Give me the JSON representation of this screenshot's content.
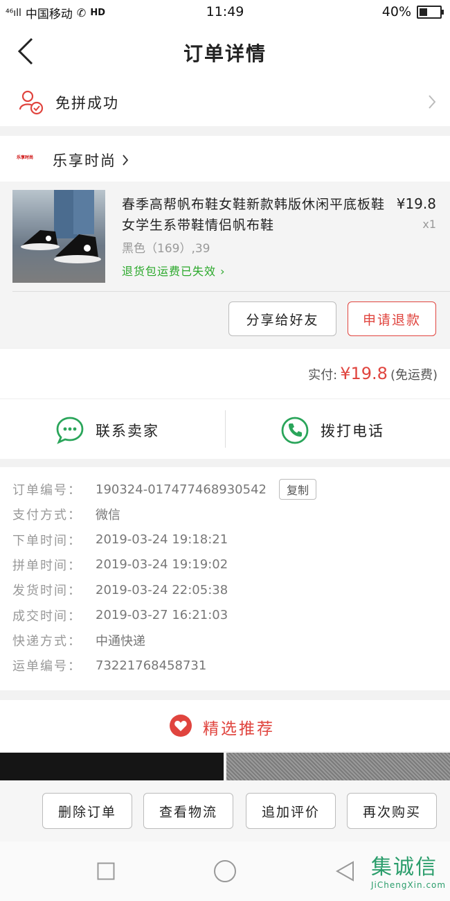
{
  "status_bar": {
    "network": "⁴⁶ıll",
    "carrier": "中国移动",
    "hd": "HD",
    "time": "11:49",
    "battery_label": "40%",
    "battery_level": 0.4
  },
  "header": {
    "title": "订单详情"
  },
  "group_status": {
    "label": "免拼成功"
  },
  "shop": {
    "logo_text": "乐享时尚",
    "name": "乐享时尚"
  },
  "product": {
    "title": "春季高帮帆布鞋女鞋新款韩版休闲平底板鞋女学生系带鞋情侣帆布鞋",
    "spec": "黑色（169）,39",
    "return_shipping": "退货包运费已失效",
    "price": "¥19.8",
    "qty": "x1"
  },
  "actions": {
    "share": "分享给好友",
    "refund": "申请退款"
  },
  "payment": {
    "label": "实付:",
    "amount": "¥19.8",
    "note": "(免运费)"
  },
  "contact": {
    "seller": "联系卖家",
    "phone": "拨打电话"
  },
  "order_info": {
    "copy_label": "复制",
    "rows": [
      {
        "k": "订单编号：",
        "v": "190324-017477468930542"
      },
      {
        "k": "支付方式：",
        "v": "微信"
      },
      {
        "k": "下单时间：",
        "v": "2019-03-24 19:18:21"
      },
      {
        "k": "拼单时间：",
        "v": "2019-03-24 19:19:02"
      },
      {
        "k": "发货时间：",
        "v": "2019-03-24 22:05:38"
      },
      {
        "k": "成交时间：",
        "v": "2019-03-27 16:21:03"
      },
      {
        "k": "快递方式：",
        "v": "中通快递"
      },
      {
        "k": "运单编号：",
        "v": "73221768458731"
      }
    ]
  },
  "recommend": {
    "label": "精选推荐"
  },
  "bottom_actions": {
    "delete": "删除订单",
    "logistics": "查看物流",
    "review": "追加评价",
    "rebuy": "再次购买"
  },
  "watermark": {
    "text": "集诚信",
    "domain": "JiChengXin.com"
  },
  "colors": {
    "accent": "#e0443e",
    "green": "#2aa82a",
    "wechat_green": "#2aa55a"
  }
}
